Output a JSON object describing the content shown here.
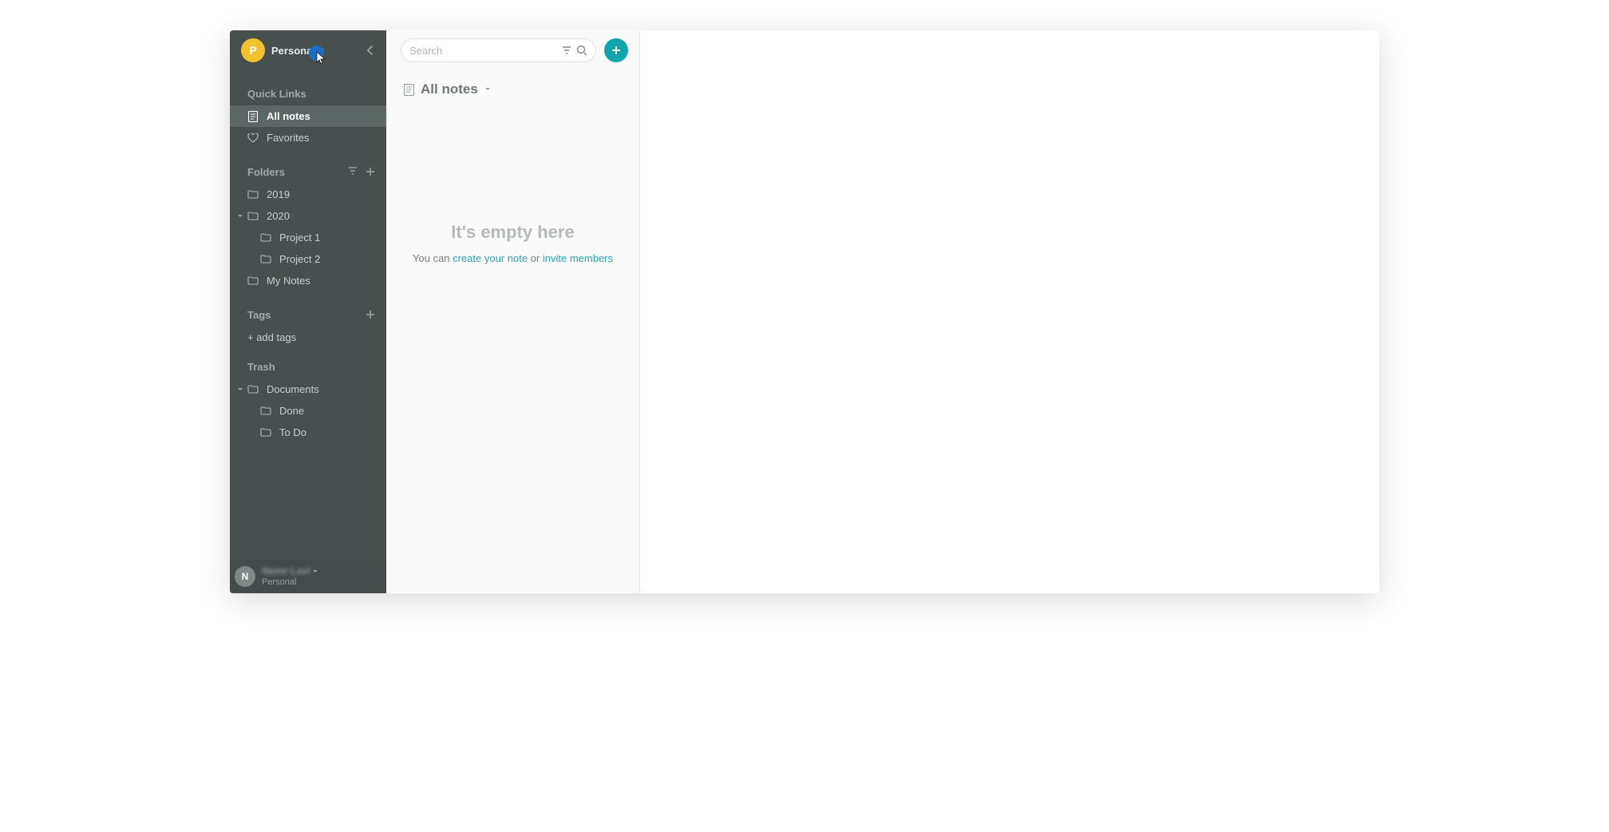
{
  "workspace": {
    "initial": "P",
    "name": "Personal"
  },
  "sidebar": {
    "quick_links_header": "Quick Links",
    "all_notes": "All notes",
    "favorites": "Favorites",
    "folders_header": "Folders",
    "folders": {
      "f0": "2019",
      "f1": "2020",
      "f1_children": {
        "c0": "Project 1",
        "c1": "Project 2"
      },
      "f2": "My Notes"
    },
    "tags_header": "Tags",
    "add_tags": "+ add tags",
    "trash_header": "Trash",
    "trash": {
      "t0": "Documents",
      "t0_children": {
        "c0": "Done",
        "c1": "To Do"
      }
    }
  },
  "footer": {
    "initial": "N",
    "name": "Name Last",
    "role": "Personal"
  },
  "list": {
    "search_placeholder": "Search",
    "title": "All notes",
    "empty_title": "It's empty here",
    "empty_prefix": "You can ",
    "empty_link1": "create your note",
    "empty_mid": " or ",
    "empty_link2": "invite members"
  }
}
